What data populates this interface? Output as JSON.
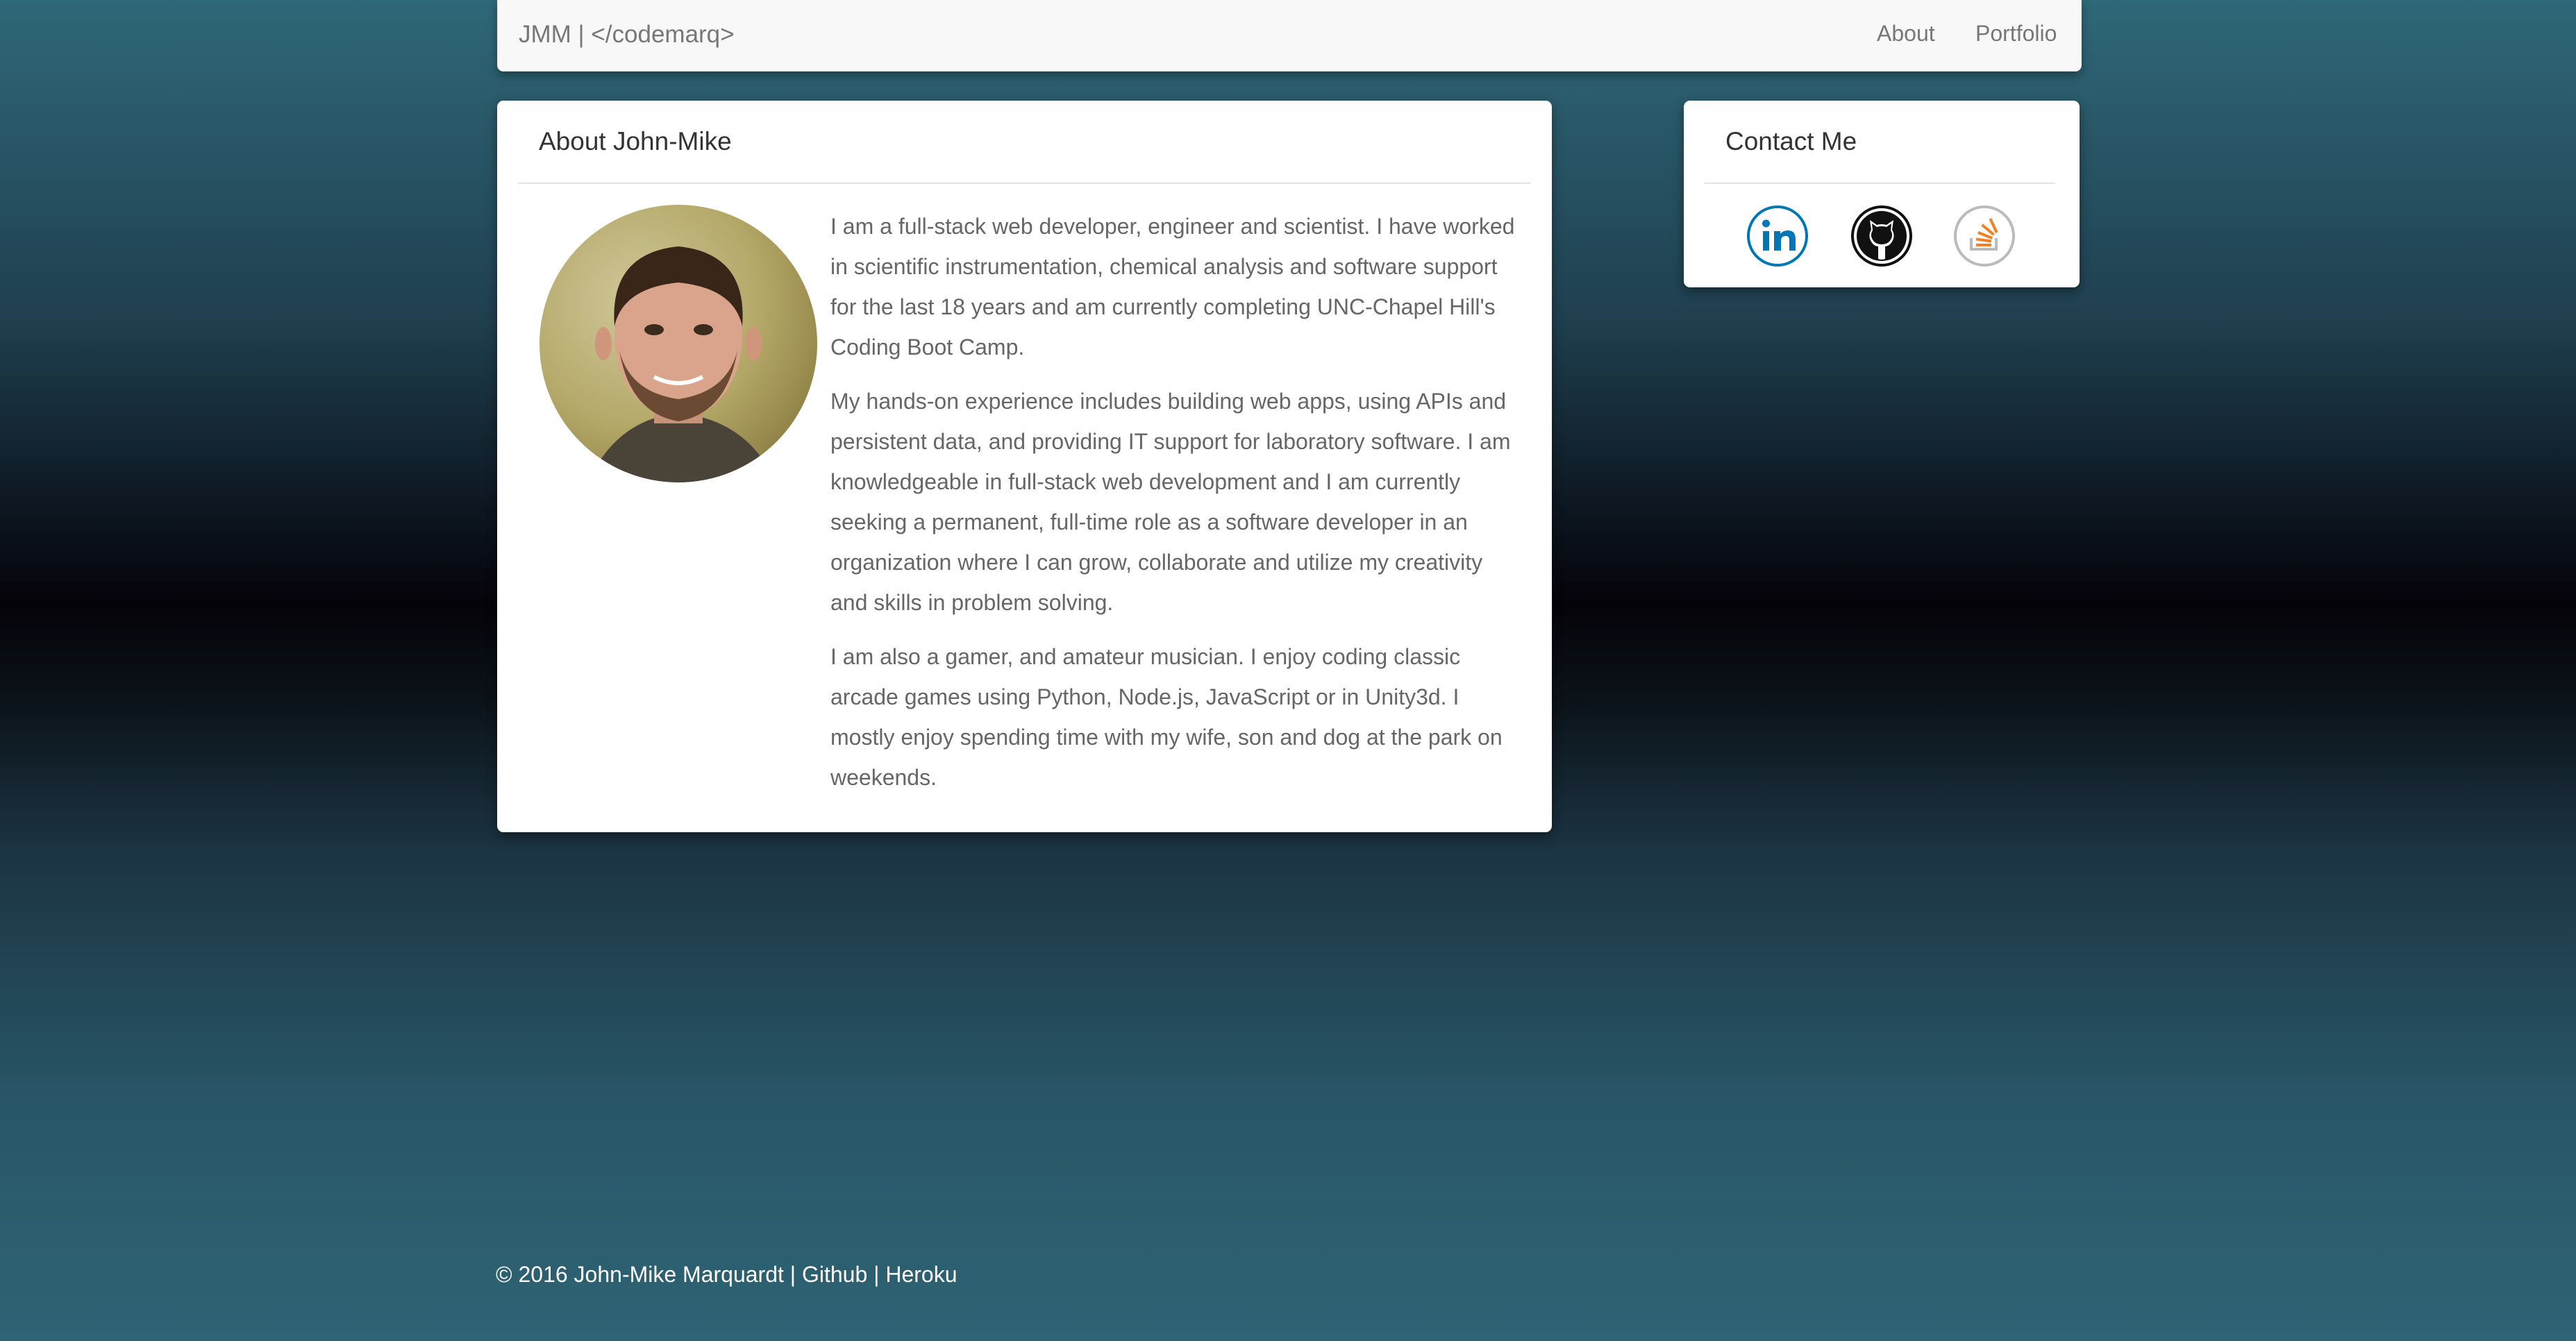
{
  "navbar": {
    "brand": "JMM | </codemarq>",
    "links": [
      "About",
      "Portfolio"
    ]
  },
  "about": {
    "heading": "About John-Mike",
    "paragraphs": [
      "I am a full-stack web developer, engineer and scientist. I have worked in scientific instrumentation, chemical analysis and software support for the last 18 years and am currently completing UNC-Chapel Hill's Coding Boot Camp.",
      "My hands-on experience includes building web apps, using APIs and persistent data, and providing IT support for laboratory software. I am knowledgeable in full-stack web development and I am currently seeking a permanent, full-time role as a software developer in an organization where I can grow, collaborate and utilize my creativity and skills in problem solving.",
      "I am also a gamer, and amateur musician. I enjoy coding classic arcade games using Python, Node.js, JavaScript or in Unity3d. I mostly enjoy spending time with my wife, son and dog at the park on weekends."
    ]
  },
  "contact": {
    "heading": "Contact Me",
    "icons": [
      "linkedin-icon",
      "github-icon",
      "stackoverflow-icon"
    ]
  },
  "footer": {
    "copyright": "© 2016 John-Mike Marquardt",
    "separator": "|",
    "links": [
      "Github",
      "Heroku"
    ]
  },
  "colors": {
    "linkedin": "#0077b5",
    "github": "#111111",
    "stackoverflow": "#f48024"
  }
}
